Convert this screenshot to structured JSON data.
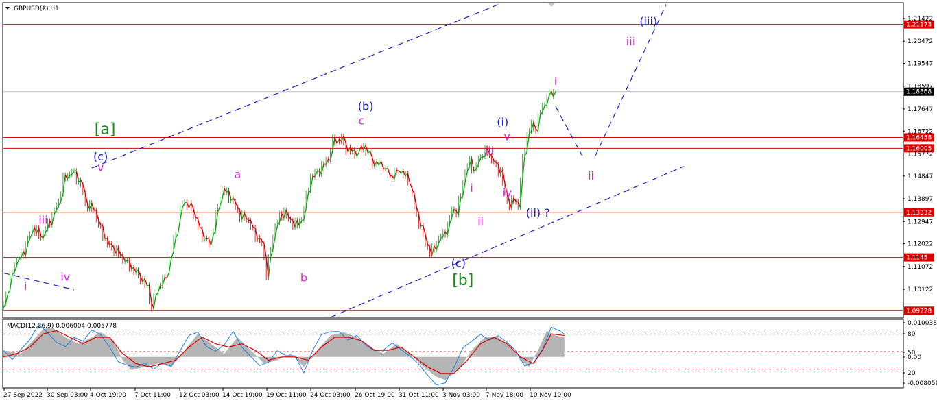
{
  "chart_data": [
    {
      "type": "line",
      "title": "GBPUSD(€),H1",
      "symbol": "GBPUSD",
      "timeframe": "H1",
      "ylim": [
        1.0895,
        1.2205
      ],
      "price_ticks": [
        1.21422,
        1.20472,
        1.19547,
        1.18597,
        1.17647,
        1.16722,
        1.15772,
        1.14847,
        1.13897,
        1.12947,
        1.12022,
        1.11072,
        1.10122
      ],
      "time_labels": [
        "27 Sep 2022",
        "30 Sep 03:00",
        "4 Oct 19:00",
        "7 Oct 11:00",
        "12 Oct 03:00",
        "14 Oct 19:00",
        "19 Oct 11:00",
        "24 Oct 03:00",
        "26 Oct 19:00",
        "31 Oct 11:00",
        "3 Nov 03:00",
        "7 Nov 18:00",
        "10 Nov 10:00"
      ],
      "current_price": {
        "value": 1.18368,
        "label": "1.18368",
        "color": "#c0c0c0"
      },
      "horizontal_levels": [
        {
          "value": 1.21173,
          "label": "1.21173"
        },
        {
          "value": 1.16458,
          "label": "1.16458"
        },
        {
          "value": 1.16005,
          "label": "1.16005"
        },
        {
          "value": 1.13332,
          "label": "1.13332"
        },
        {
          "value": 1.1145,
          "label": "1.1145"
        },
        {
          "value": 1.09228,
          "label": "1.09228"
        }
      ],
      "level_color": "#dd0000",
      "price_path": [
        [
          0,
          1.0925
        ],
        [
          3,
          1.112
        ],
        [
          5,
          1.117
        ],
        [
          7,
          1.127
        ],
        [
          9,
          1.123
        ],
        [
          11,
          1.13
        ],
        [
          13,
          1.138
        ],
        [
          14,
          1.147
        ],
        [
          16,
          1.1505
        ],
        [
          18,
          1.145
        ],
        [
          19,
          1.137
        ],
        [
          21,
          1.134
        ],
        [
          22,
          1.128
        ],
        [
          24,
          1.12
        ],
        [
          26,
          1.117
        ],
        [
          29,
          1.111
        ],
        [
          31,
          1.107
        ],
        [
          33,
          1.102
        ],
        [
          34,
          1.093
        ],
        [
          35,
          1.101
        ],
        [
          37,
          1.106
        ],
        [
          38,
          1.113
        ],
        [
          40,
          1.13
        ],
        [
          41,
          1.138
        ],
        [
          43,
          1.135
        ],
        [
          44,
          1.13
        ],
        [
          45,
          1.125
        ],
        [
          47,
          1.12
        ],
        [
          48,
          1.127
        ],
        [
          49,
          1.136
        ],
        [
          50,
          1.143
        ],
        [
          52,
          1.139
        ],
        [
          54,
          1.132
        ],
        [
          56,
          1.13
        ],
        [
          57,
          1.125
        ],
        [
          59,
          1.12
        ],
        [
          60,
          1.108
        ],
        [
          62,
          1.128
        ],
        [
          64,
          1.134
        ],
        [
          65,
          1.13
        ],
        [
          67,
          1.128
        ],
        [
          68,
          1.131
        ],
        [
          70,
          1.148
        ],
        [
          72,
          1.151
        ],
        [
          74,
          1.156
        ],
        [
          75,
          1.163
        ],
        [
          77,
          1.164
        ],
        [
          78,
          1.16
        ],
        [
          80,
          1.158
        ],
        [
          82,
          1.161
        ],
        [
          84,
          1.154
        ],
        [
          86,
          1.153
        ],
        [
          88,
          1.148
        ],
        [
          90,
          1.151
        ],
        [
          92,
          1.147
        ],
        [
          93,
          1.14
        ],
        [
          94,
          1.132
        ],
        [
          96,
          1.121
        ],
        [
          97,
          1.116
        ],
        [
          99,
          1.122
        ],
        [
          101,
          1.127
        ],
        [
          102,
          1.135
        ],
        [
          103,
          1.133
        ],
        [
          105,
          1.15
        ],
        [
          106,
          1.155
        ],
        [
          107,
          1.15
        ],
        [
          108,
          1.156
        ],
        [
          110,
          1.159
        ],
        [
          111,
          1.155
        ],
        [
          113,
          1.15
        ],
        [
          114,
          1.141
        ],
        [
          115,
          1.136
        ],
        [
          116,
          1.139
        ],
        [
          117,
          1.136
        ],
        [
          118,
          1.156
        ],
        [
          119,
          1.165
        ],
        [
          120,
          1.17
        ],
        [
          121,
          1.168
        ],
        [
          122,
          1.176
        ],
        [
          123,
          1.179
        ],
        [
          124,
          1.183
        ],
        [
          125,
          1.1837
        ]
      ],
      "x_total": 129,
      "wave_labels": [
        {
          "text": "[a]",
          "color": "#1a8a1a",
          "x": 23,
          "y": 1.166,
          "size": "big"
        },
        {
          "text": "[b]",
          "color": "#1a8a1a",
          "x": 104,
          "y": 1.103,
          "size": "big"
        },
        {
          "text": "(c)",
          "color": "#1b1bc8",
          "x": 22,
          "y": 1.155,
          "size": "n"
        },
        {
          "text": "(b)",
          "color": "#1b1bc8",
          "x": 82,
          "y": 1.176,
          "size": "n"
        },
        {
          "text": "(c)",
          "color": "#1b1bc8",
          "x": 103,
          "y": 1.1105,
          "size": "n"
        },
        {
          "text": "(i)",
          "color": "#1b1bc8",
          "x": 113,
          "y": 1.1695,
          "size": "n"
        },
        {
          "text": "(ii) ?",
          "color": "#1b1bc8",
          "x": 121,
          "y": 1.1315,
          "size": "n"
        },
        {
          "text": "(iii)",
          "color": "#1b1bc8",
          "x": 146,
          "y": 1.2115,
          "size": "n"
        },
        {
          "text": "i",
          "color": "#dd22dd",
          "x": 5,
          "y": 1.101,
          "size": "n"
        },
        {
          "text": "iii",
          "color": "#dd22dd",
          "x": 9,
          "y": 1.1285,
          "size": "n"
        },
        {
          "text": "iv",
          "color": "#dd22dd",
          "x": 14,
          "y": 1.1048,
          "size": "n"
        },
        {
          "text": "v",
          "color": "#dd22dd",
          "x": 22,
          "y": 1.1505,
          "size": "n"
        },
        {
          "text": "a",
          "color": "#dd22dd",
          "x": 53,
          "y": 1.1475,
          "size": "n"
        },
        {
          "text": "b",
          "color": "#dd22dd",
          "x": 68,
          "y": 1.1045,
          "size": "n"
        },
        {
          "text": "c",
          "color": "#dd22dd",
          "x": 81,
          "y": 1.17,
          "size": "n"
        },
        {
          "text": "i",
          "color": "#dd22dd",
          "x": 106,
          "y": 1.142,
          "size": "n"
        },
        {
          "text": "ii",
          "color": "#dd22dd",
          "x": 108,
          "y": 1.128,
          "size": "n"
        },
        {
          "text": "iii",
          "color": "#dd22dd",
          "x": 110,
          "y": 1.1575,
          "size": "n"
        },
        {
          "text": "iv",
          "color": "#dd22dd",
          "x": 114,
          "y": 1.14,
          "size": "n"
        },
        {
          "text": "v",
          "color": "#dd22dd",
          "x": 114,
          "y": 1.1635,
          "size": "n"
        },
        {
          "text": "i",
          "color": "#dd22dd",
          "x": 125,
          "y": 1.1865,
          "size": "n"
        },
        {
          "text": "ii",
          "color": "#dd22dd",
          "x": 133,
          "y": 1.147,
          "size": "n"
        },
        {
          "text": "iii",
          "color": "#dd22dd",
          "x": 142,
          "y": 1.203,
          "size": "n"
        }
      ],
      "trend_lines": [
        {
          "from": [
            20,
            1.1518
          ],
          "to": [
            112,
            1.22
          ],
          "color": "#1b1bc8"
        },
        {
          "from": [
            74,
            1.0895
          ],
          "to": [
            154,
            1.1525
          ],
          "color": "#1b1bc8"
        },
        {
          "from": [
            0,
            1.108
          ],
          "to": [
            16,
            1.101
          ],
          "color": "#1b1bc8"
        },
        {
          "from": [
            125,
            1.1775
          ],
          "to": [
            131,
            1.157
          ],
          "color": "#1b1bc8"
        },
        {
          "from": [
            134,
            1.157
          ],
          "to": [
            150,
            1.22
          ],
          "color": "#1b1bc8"
        }
      ]
    },
    {
      "type": "area",
      "title": "MACD(12,26,9) 0.006004 0.005778",
      "indicator": "MACD",
      "params": "12,26,9",
      "main_value": "0.006004",
      "signal_value": "0.005778",
      "ylim": [
        -0.0092,
        0.0112
      ],
      "right_labels": [
        "0.010038",
        "80",
        "50",
        "0.00",
        "20",
        "-0.008059"
      ],
      "levels": [
        80,
        50,
        20
      ],
      "level_values": [
        0.0069,
        0.0016,
        -0.0037
      ],
      "histogram": [
        [
          0,
          0.002
        ],
        [
          4,
          0.001
        ],
        [
          6,
          0.004
        ],
        [
          9,
          0.0085
        ],
        [
          11,
          0.009
        ],
        [
          14,
          0.006
        ],
        [
          17,
          0.004
        ],
        [
          20,
          0.006
        ],
        [
          22,
          0.0075
        ],
        [
          25,
          0.005
        ],
        [
          27,
          -0.001
        ],
        [
          29,
          -0.004
        ],
        [
          32,
          -0.003
        ],
        [
          35,
          -0.002
        ],
        [
          38,
          -0.003
        ],
        [
          41,
          0.002
        ],
        [
          44,
          0.007
        ],
        [
          47,
          0.004
        ],
        [
          50,
          0.001
        ],
        [
          53,
          0.006
        ],
        [
          56,
          0.002
        ],
        [
          59,
          -0.002
        ],
        [
          62,
          -0.001
        ],
        [
          65,
          0.001
        ],
        [
          68,
          -0.003
        ],
        [
          71,
          0.002
        ],
        [
          74,
          0.0065
        ],
        [
          77,
          0.0075
        ],
        [
          80,
          0.006
        ],
        [
          83,
          0.003
        ],
        [
          86,
          0.001
        ],
        [
          89,
          0.004
        ],
        [
          92,
          0.001
        ],
        [
          95,
          -0.003
        ],
        [
          98,
          -0.006
        ],
        [
          100,
          -0.007
        ],
        [
          103,
          -0.004
        ],
        [
          106,
          0.002
        ],
        [
          109,
          0.006
        ],
        [
          112,
          0.006
        ],
        [
          115,
          0.003
        ],
        [
          117,
          -0.001
        ],
        [
          119,
          -0.003
        ],
        [
          121,
          0.002
        ],
        [
          123,
          0.008
        ],
        [
          125,
          0.0065
        ],
        [
          127,
          0.006
        ]
      ],
      "signal_line": [
        [
          0,
          0.0
        ],
        [
          3,
          0.001
        ],
        [
          6,
          0.003
        ],
        [
          9,
          0.007
        ],
        [
          12,
          0.008
        ],
        [
          15,
          0.006
        ],
        [
          18,
          0.004
        ],
        [
          21,
          0.006
        ],
        [
          24,
          0.006
        ],
        [
          27,
          0.001
        ],
        [
          30,
          -0.002
        ],
        [
          33,
          -0.003
        ],
        [
          36,
          -0.002
        ],
        [
          39,
          -0.001
        ],
        [
          42,
          0.003
        ],
        [
          45,
          0.006
        ],
        [
          48,
          0.004
        ],
        [
          51,
          0.003
        ],
        [
          54,
          0.004
        ],
        [
          57,
          0.002
        ],
        [
          60,
          -0.001
        ],
        [
          63,
          0.0
        ],
        [
          66,
          0.0
        ],
        [
          69,
          -0.001
        ],
        [
          72,
          0.003
        ],
        [
          75,
          0.006
        ],
        [
          78,
          0.006
        ],
        [
          81,
          0.005
        ],
        [
          84,
          0.002
        ],
        [
          87,
          0.002
        ],
        [
          90,
          0.003
        ],
        [
          93,
          0.0
        ],
        [
          96,
          -0.003
        ],
        [
          99,
          -0.005
        ],
        [
          102,
          -0.005
        ],
        [
          105,
          -0.001
        ],
        [
          108,
          0.004
        ],
        [
          111,
          0.006
        ],
        [
          114,
          0.004
        ],
        [
          117,
          0.0
        ],
        [
          120,
          -0.002
        ],
        [
          122,
          0.002
        ],
        [
          124,
          0.007
        ],
        [
          127,
          0.0065
        ]
      ],
      "main_line": [
        [
          0,
          0.002
        ],
        [
          2,
          0.0
        ],
        [
          4,
          0.003
        ],
        [
          6,
          0.005
        ],
        [
          8,
          0.009
        ],
        [
          10,
          0.007
        ],
        [
          12,
          0.005
        ],
        [
          14,
          0.004
        ],
        [
          16,
          0.006
        ],
        [
          18,
          0.004
        ],
        [
          20,
          0.0075
        ],
        [
          22,
          0.007
        ],
        [
          24,
          0.004
        ],
        [
          26,
          -0.001
        ],
        [
          28,
          -0.003
        ],
        [
          30,
          -0.004
        ],
        [
          32,
          -0.002
        ],
        [
          34,
          -0.003
        ],
        [
          36,
          -0.001
        ],
        [
          38,
          -0.003
        ],
        [
          40,
          0.001
        ],
        [
          42,
          0.006
        ],
        [
          44,
          0.008
        ],
        [
          46,
          0.004
        ],
        [
          48,
          0.002
        ],
        [
          50,
          0.003
        ],
        [
          52,
          0.007
        ],
        [
          54,
          0.003
        ],
        [
          56,
          0.001
        ],
        [
          58,
          -0.002
        ],
        [
          60,
          -0.002
        ],
        [
          62,
          0.001
        ],
        [
          64,
          0.0
        ],
        [
          66,
          0.001
        ],
        [
          68,
          -0.004
        ],
        [
          70,
          0.002
        ],
        [
          72,
          0.006
        ],
        [
          74,
          0.007
        ],
        [
          76,
          0.008
        ],
        [
          78,
          0.006
        ],
        [
          80,
          0.007
        ],
        [
          82,
          0.003
        ],
        [
          84,
          0.001
        ],
        [
          86,
          0.002
        ],
        [
          88,
          0.005
        ],
        [
          90,
          0.003
        ],
        [
          92,
          0.0
        ],
        [
          94,
          -0.003
        ],
        [
          96,
          -0.006
        ],
        [
          98,
          -0.008
        ],
        [
          100,
          -0.007
        ],
        [
          102,
          -0.003
        ],
        [
          104,
          0.002
        ],
        [
          106,
          0.004
        ],
        [
          108,
          0.007
        ],
        [
          110,
          0.006
        ],
        [
          112,
          0.007
        ],
        [
          114,
          0.004
        ],
        [
          116,
          0.001
        ],
        [
          118,
          -0.003
        ],
        [
          120,
          -0.001
        ],
        [
          122,
          0.003
        ],
        [
          124,
          0.009
        ],
        [
          126,
          0.007
        ],
        [
          127,
          0.006
        ]
      ],
      "colors": {
        "histogram": "#b4b4b4",
        "main": "#1e7fe0",
        "signal": "#dd0000",
        "levels": "#dd0000"
      }
    }
  ]
}
